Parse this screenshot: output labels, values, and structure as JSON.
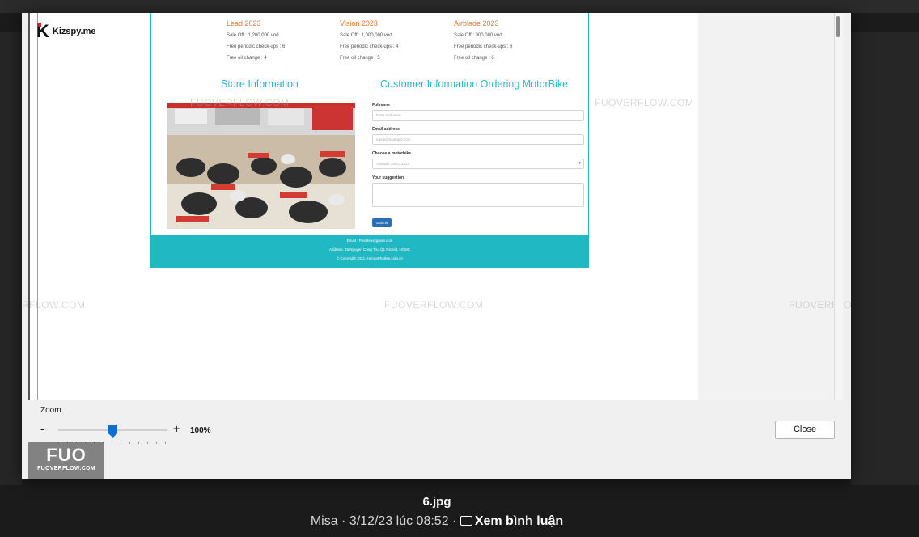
{
  "dialog": {
    "logo_letter": "K",
    "logo_text": "Kizspy.me"
  },
  "webpage": {
    "products": [
      {
        "name": "Lead 2023",
        "sale": "Sale Off : 1,200,000 vnd",
        "checkups": "Free periodic check-ups : 6",
        "oil": "Free oil change : 4"
      },
      {
        "name": "Vision 2023",
        "sale": "Sale Off : 1,000,000 vnd",
        "checkups": "Free periodic check-ups : 4",
        "oil": "Free oil change : 5"
      },
      {
        "name": "Airblade 2023",
        "sale": "Sale Off : 900,000 vnd",
        "checkups": "Free periodic check-ups : 6",
        "oil": "Free oil change : 6"
      }
    ],
    "store_title": "Store Information",
    "customer_title": "Customer Information Ordering MotorBike",
    "form": {
      "fullname_label": "Fullname",
      "fullname_placeholder": "Enter Fullname",
      "email_label": "Email address",
      "email_placeholder": "name@example.com",
      "motorbike_label": "Choose a motorbike",
      "motorbike_value": "Airblade 150cc 2023",
      "suggestion_label": "Your suggestion",
      "submit_label": "Submit"
    },
    "footer": {
      "email": "Email : Phatttee@gmail.com",
      "address": "Address: 15 Nguyen Cong Tru, Q1 District, HCMC",
      "copyright": "© Copyright 2021. HondaPhattee.com.vn"
    }
  },
  "watermarks": [
    "FUOVERFLOW.COM",
    "FUOVERFLOW.COM",
    "RFLOW.COM",
    "FUOVERFLO",
    "FUOVERFLOW.COM"
  ],
  "controls": {
    "zoom_label": "Zoom",
    "zoom_minus": "-",
    "zoom_plus": "+",
    "zoom_value": "100%",
    "zoom_level": 0.5,
    "close_label": "Close"
  },
  "fuo_logo": {
    "big": "FUO",
    "small": "FUOVERFLOW.COM"
  },
  "caption": {
    "filename": "6.jpg",
    "meta": "Misa · 3/12/23 lúc 08:52 · ",
    "comments_label": "Xem bình luận"
  },
  "colors": {
    "accent": "#23b9c2",
    "product_name": "#e07a2f",
    "zoom_thumb": "#0d6fd3"
  }
}
